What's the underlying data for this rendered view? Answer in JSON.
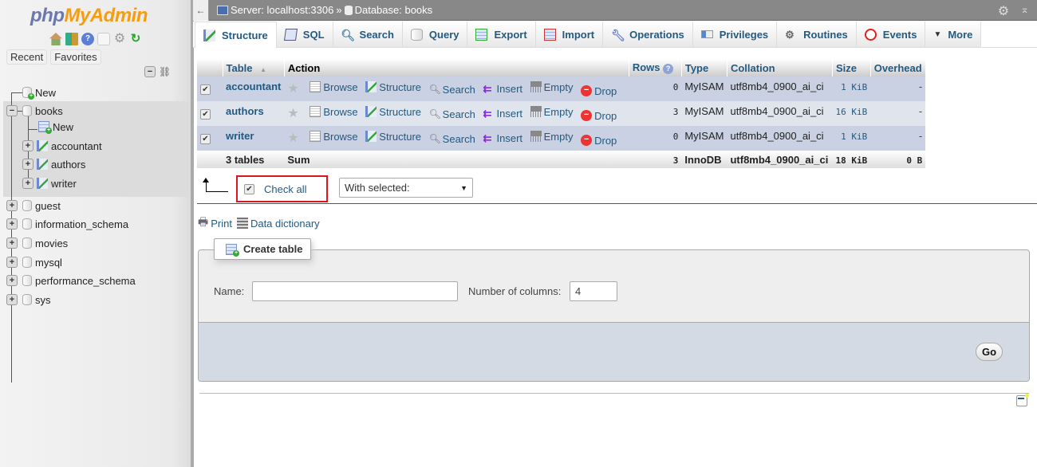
{
  "sidebar": {
    "logo_php": "php",
    "logo_myadmin": "MyAdmin",
    "logo_icons": [
      "home-icon",
      "logout-icon",
      "help-icon",
      "docs-icon",
      "settings-icon",
      "reload-icon"
    ],
    "recent_label": "Recent",
    "favorites_label": "Favorites",
    "new_label": "New",
    "databases": [
      {
        "name": "books",
        "expanded": true,
        "children": [
          {
            "name": "New",
            "kind": "new-table"
          },
          {
            "name": "accountant",
            "kind": "table"
          },
          {
            "name": "authors",
            "kind": "table"
          },
          {
            "name": "writer",
            "kind": "table"
          }
        ]
      },
      {
        "name": "guest"
      },
      {
        "name": "information_schema"
      },
      {
        "name": "movies"
      },
      {
        "name": "mysql"
      },
      {
        "name": "performance_schema"
      },
      {
        "name": "sys"
      }
    ]
  },
  "topbar": {
    "back_label": "←",
    "server": "Server: localhost:3306",
    "separator": "»",
    "database": "Database: books"
  },
  "tabs": [
    {
      "label": "Structure",
      "icon": "structure-icon",
      "active": true
    },
    {
      "label": "SQL",
      "icon": "sql-icon"
    },
    {
      "label": "Search",
      "icon": "search-icon"
    },
    {
      "label": "Query",
      "icon": "query-icon"
    },
    {
      "label": "Export",
      "icon": "export-icon"
    },
    {
      "label": "Import",
      "icon": "import-icon"
    },
    {
      "label": "Operations",
      "icon": "operations-icon"
    },
    {
      "label": "Privileges",
      "icon": "privileges-icon"
    },
    {
      "label": "Routines",
      "icon": "routines-icon"
    },
    {
      "label": "Events",
      "icon": "events-icon"
    },
    {
      "label": "More",
      "icon": "caret-down-icon"
    }
  ],
  "table": {
    "headers": {
      "table": "Table",
      "sort": "▲",
      "action": "Action",
      "rows": "Rows",
      "type": "Type",
      "collation": "Collation",
      "size": "Size",
      "overhead": "Overhead"
    },
    "actions": [
      "Browse",
      "Structure",
      "Search",
      "Insert",
      "Empty",
      "Drop"
    ],
    "rows": [
      {
        "name": "accountant",
        "rows": "0",
        "type": "MyISAM",
        "collation": "utf8mb4_0900_ai_ci",
        "size": "1 KiB",
        "overhead": "-",
        "checked": true
      },
      {
        "name": "authors",
        "rows": "3",
        "type": "MyISAM",
        "collation": "utf8mb4_0900_ai_ci",
        "size": "16 KiB",
        "overhead": "-",
        "checked": true
      },
      {
        "name": "writer",
        "rows": "0",
        "type": "MyISAM",
        "collation": "utf8mb4_0900_ai_ci",
        "size": "1 KiB",
        "overhead": "-",
        "checked": true
      }
    ],
    "footer": {
      "count": "3 tables",
      "sum": "Sum",
      "rows": "3",
      "type": "InnoDB",
      "collation": "utf8mb4_0900_ai_ci",
      "size": "18 KiB",
      "overhead": "0 B"
    }
  },
  "bulk": {
    "check_all": "Check all",
    "with_selected": "With selected:"
  },
  "links": {
    "print": "Print",
    "data_dictionary": "Data dictionary"
  },
  "create_table": {
    "legend": "Create table",
    "name_label": "Name:",
    "name_value": "",
    "columns_label": "Number of columns:",
    "columns_value": "4",
    "go_label": "Go"
  }
}
